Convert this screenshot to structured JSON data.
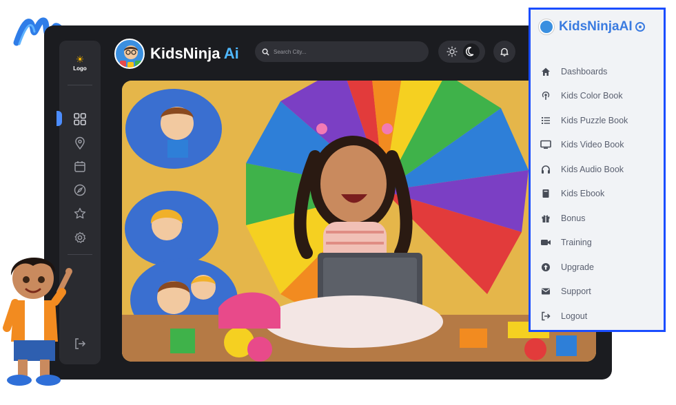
{
  "app": {
    "brand_primary": "KidsNinja",
    "brand_accent": "Ai",
    "logo_label": "Logo",
    "search_placeholder": "Search City...",
    "colors": {
      "window_bg": "#1b1c20",
      "rail_bg": "#2a2b30",
      "accent_blue": "#4fb8ff",
      "active_mark": "#4c8dff"
    },
    "rail_icons": [
      "grid-icon",
      "location-pin-icon",
      "calendar-icon",
      "compass-icon",
      "star-icon",
      "settings-icon",
      "logout-icon"
    ],
    "theme_toggle": {
      "options": [
        "sun-icon",
        "moon-icon"
      ],
      "active": "moon-icon"
    }
  },
  "menu": {
    "title": "KidsNinjaAI",
    "border_color": "#1a4dff",
    "title_color": "#3a7be0",
    "items": [
      {
        "label": "Dashboards",
        "icon": "home-icon"
      },
      {
        "label": "Kids Color Book",
        "icon": "podcast-icon"
      },
      {
        "label": "Kids Puzzle Book",
        "icon": "list-icon"
      },
      {
        "label": "Kids Video Book",
        "icon": "monitor-icon"
      },
      {
        "label": "Kids Audio Book",
        "icon": "headphones-icon"
      },
      {
        "label": "Kids Ebook",
        "icon": "book-icon"
      },
      {
        "label": "Bonus",
        "icon": "gift-icon"
      },
      {
        "label": "Training",
        "icon": "video-camera-icon"
      },
      {
        "label": "Upgrade",
        "icon": "arrow-up-circle-icon"
      },
      {
        "label": "Support",
        "icon": "envelope-icon"
      },
      {
        "label": "Logout",
        "icon": "sign-out-icon"
      }
    ]
  }
}
